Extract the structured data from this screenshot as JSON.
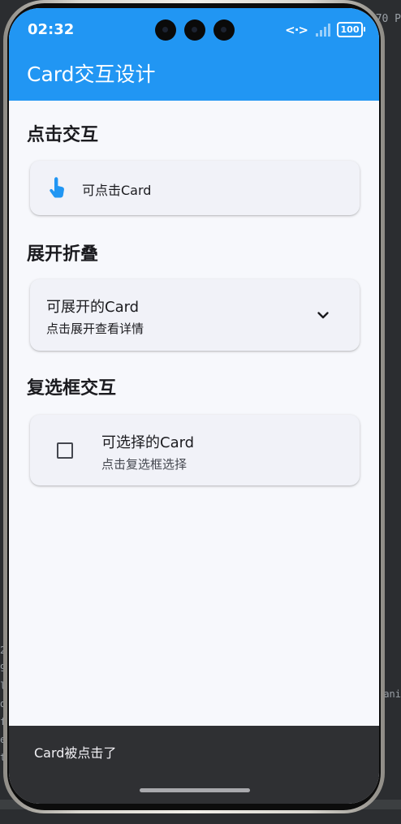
{
  "ide": {
    "right_top_text": "70 P",
    "right_mid_text": "ani",
    "gutter_chars": [
      "2",
      "9",
      "l",
      "d",
      "f",
      "e",
      "t"
    ]
  },
  "status_bar": {
    "time": "02:32",
    "battery": "100"
  },
  "app_bar": {
    "title": "Card交互设计"
  },
  "sections": {
    "click": {
      "title": "点击交互",
      "card_label": "可点击Card",
      "icon": "touch-app-icon"
    },
    "expand": {
      "title": "展开折叠",
      "card_title": "可展开的Card",
      "card_subtitle": "点击展开查看详情",
      "icon": "chevron-down-icon"
    },
    "checkbox": {
      "title": "复选框交互",
      "card_title": "可选择的Card",
      "card_subtitle": "点击复选框选择",
      "checked": false
    }
  },
  "snackbar": {
    "message": "Card被点击了"
  },
  "colors": {
    "primary": "#2196f3",
    "background": "#f7f8fc",
    "card": "#f1f2f8",
    "snackbar": "#2f3033"
  }
}
